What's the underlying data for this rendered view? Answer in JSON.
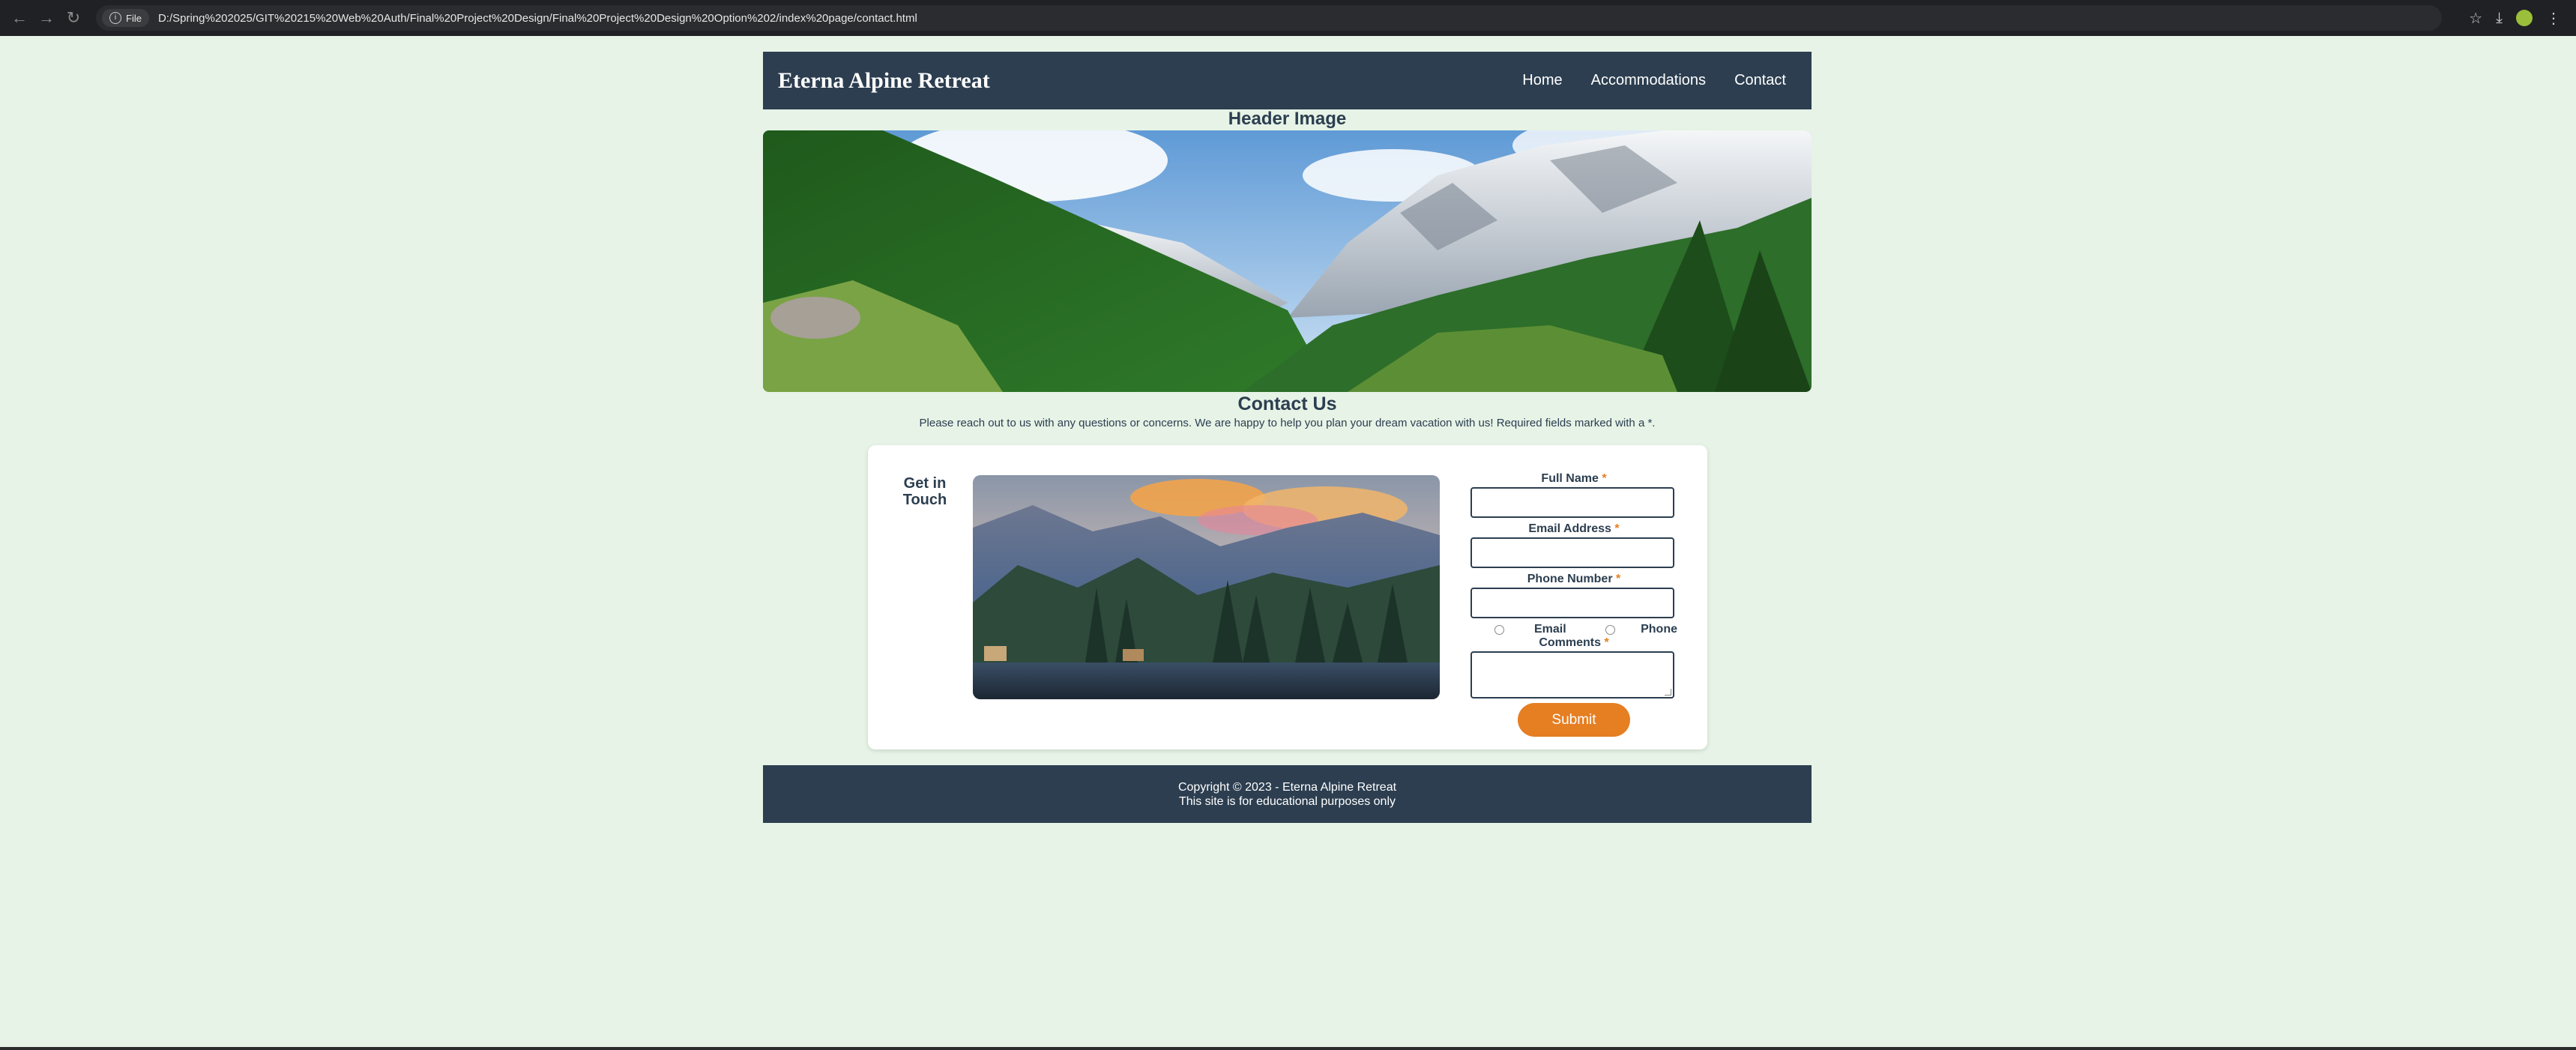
{
  "browser": {
    "file_label": "File",
    "url": "D:/Spring%202025/GIT%20215%20Web%20Auth/Final%20Project%20Design/Final%20Project%20Design%20Option%202/index%20page/contact.html"
  },
  "site": {
    "brand": "Eterna Alpine Retreat",
    "nav": [
      "Home",
      "Accommodations",
      "Contact"
    ],
    "header_image_title": "Header Image",
    "contact_title": "Contact Us",
    "contact_subtitle": "Please reach out to us with any questions or concerns. We are happy to help you plan your dream vacation with us! Required fields marked with a *.",
    "card": {
      "heading_line1": "Get in",
      "heading_line2": "Touch",
      "form": {
        "full_name_label": "Full Name",
        "email_label": "Email Address",
        "phone_label": "Phone Number",
        "required_mark": "*",
        "radio_email": "Email",
        "radio_phone": "Phone",
        "comments_label": "Comments",
        "submit_label": "Submit"
      }
    },
    "footer": {
      "line1": "Copyright © 2023 - Eterna Alpine Retreat",
      "line2": "This site is for educational purposes only"
    }
  },
  "colors": {
    "page_bg": "#e6f3e6",
    "navy": "#2c3e50",
    "accent": "#e67e22"
  }
}
